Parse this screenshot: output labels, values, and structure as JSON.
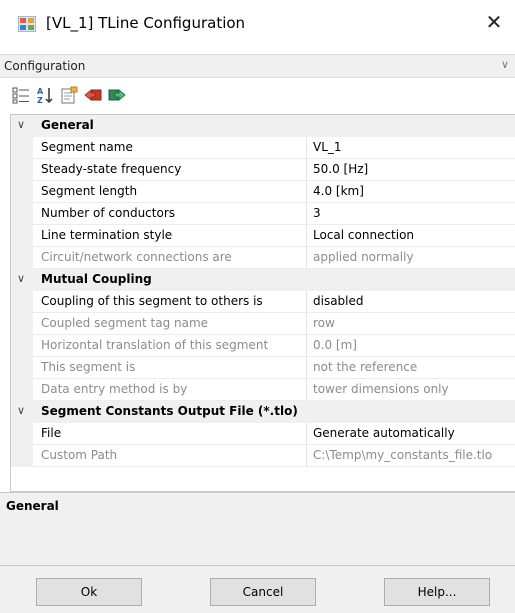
{
  "window": {
    "title": "[VL_1] TLine Configuration",
    "close_glyph": "✕"
  },
  "config_bar": {
    "label": "Configuration",
    "chevron": "∨"
  },
  "toolbar": {
    "buttons": [
      "categorized-view-icon",
      "alphabetical-sort-icon",
      "property-pages-icon",
      "import-icon",
      "export-icon"
    ]
  },
  "grid": {
    "expand_glyph": "∨",
    "categories": [
      {
        "name": "General",
        "rows": [
          {
            "name": "Segment name",
            "value": "VL_1",
            "enabled": true
          },
          {
            "name": "Steady-state frequency",
            "value": "50.0 [Hz]",
            "enabled": true
          },
          {
            "name": "Segment length",
            "value": "4.0 [km]",
            "enabled": true
          },
          {
            "name": "Number of conductors",
            "value": "3",
            "enabled": true
          },
          {
            "name": "Line termination style",
            "value": "Local connection",
            "enabled": true
          },
          {
            "name": "Circuit/network connections are",
            "value": "applied normally",
            "enabled": false
          }
        ]
      },
      {
        "name": "Mutual Coupling",
        "rows": [
          {
            "name": "Coupling of this segment to others is",
            "value": "disabled",
            "enabled": true
          },
          {
            "name": "Coupled segment tag name",
            "value": "row",
            "enabled": false
          },
          {
            "name": "Horizontal translation of this segment",
            "value": "0.0 [m]",
            "enabled": false
          },
          {
            "name": "This segment is",
            "value": "not the reference",
            "enabled": false
          },
          {
            "name": "Data entry method is by",
            "value": "tower dimensions only",
            "enabled": false
          }
        ]
      },
      {
        "name": "Segment Constants Output File (*.tlo)",
        "rows": [
          {
            "name": "File",
            "value": "Generate automatically",
            "enabled": true
          },
          {
            "name": "Custom Path",
            "value": "C:\\Temp\\my_constants_file.tlo",
            "enabled": false
          }
        ]
      }
    ]
  },
  "description": {
    "title": "General"
  },
  "buttons": {
    "ok": "Ok",
    "cancel": "Cancel",
    "help": "Help..."
  },
  "colors": {
    "panel_bg": "#f0f0f0",
    "disabled_text": "#8c8c8c",
    "button_bg": "#e1e1e1"
  }
}
